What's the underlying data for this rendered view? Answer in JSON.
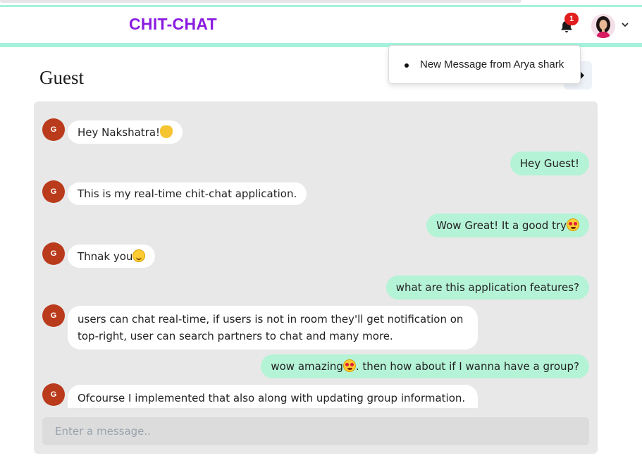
{
  "navbar": {
    "brand": "CHIT-CHAT",
    "notification_count": "1",
    "icons": {
      "bell": "bell-icon",
      "avatar": "user-avatar",
      "chevron": "chevron-down-icon"
    },
    "colors": {
      "brand": "#8a1be0",
      "accent_border": "#a6f2dc",
      "badge": "#e11d1d"
    }
  },
  "notification_menu": {
    "items": [
      "New Message from Arya shark"
    ]
  },
  "chat_header": {
    "title": "Guest"
  },
  "messages": [
    {
      "sender": "G",
      "side": "in",
      "text": "Hey Nakshatra!",
      "emoji": "wave"
    },
    {
      "side": "out",
      "text": "Hey Guest!"
    },
    {
      "sender": "G",
      "side": "in",
      "text": "This is my real-time chit-chat application."
    },
    {
      "side": "out",
      "text": "Wow Great! It a good try",
      "emoji": "heart-eyes"
    },
    {
      "sender": "G",
      "side": "in",
      "text": "Thnak you",
      "emoji": "smile"
    },
    {
      "side": "out",
      "text": "what are this application features?"
    },
    {
      "sender": "G",
      "side": "in",
      "text": "users can chat real-time, if users is not in room they'll get notification on top-right, user can search partners to chat and many more."
    },
    {
      "side": "out",
      "text_before": "wow amazing",
      "emoji": "heart-eyes",
      "text_after": ". then how about if I wanna have a group?"
    },
    {
      "sender": "G",
      "side": "in",
      "text": "Ofcourse I implemented that also along with updating group information. you"
    }
  ],
  "composer": {
    "placeholder": "Enter a message.."
  },
  "colors": {
    "incoming_bubble": "#ffffff",
    "outgoing_bubble": "#b5f3d6",
    "avatar_bg": "#b93b1c",
    "panel_bg": "#e8e8e8"
  }
}
